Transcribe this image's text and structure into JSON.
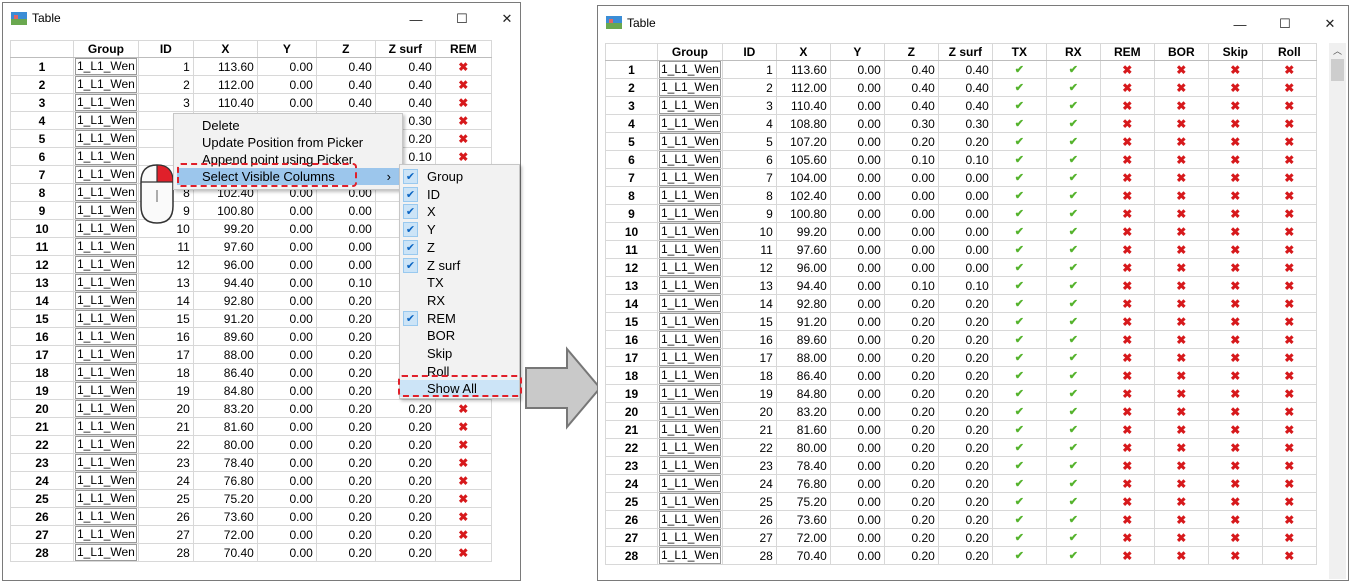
{
  "left_window": {
    "title": "Table",
    "minimize_label": "—",
    "maximize_label": "☐",
    "close_label": "✕",
    "columns": [
      "Group",
      "ID",
      "X",
      "Y",
      "Z",
      "Z surf",
      "REM"
    ],
    "context_menu": {
      "items": [
        "Delete",
        "Update Position from Picker",
        "Append point using Picker",
        "Select Visible Columns"
      ],
      "submenu_arrow": "›",
      "submenu": {
        "items": [
          {
            "label": "Group",
            "checked": true
          },
          {
            "label": "ID",
            "checked": true
          },
          {
            "label": "X",
            "checked": true
          },
          {
            "label": "Y",
            "checked": true
          },
          {
            "label": "Z",
            "checked": true
          },
          {
            "label": "Z surf",
            "checked": true
          },
          {
            "label": "TX",
            "checked": false
          },
          {
            "label": "RX",
            "checked": false
          },
          {
            "label": "REM",
            "checked": true
          },
          {
            "label": "BOR",
            "checked": false
          },
          {
            "label": "Skip",
            "checked": false
          },
          {
            "label": "Roll",
            "checked": false
          },
          {
            "label": "Show All",
            "checked": false
          }
        ]
      }
    }
  },
  "right_window": {
    "title": "Table",
    "minimize_label": "—",
    "maximize_label": "☐",
    "close_label": "✕",
    "columns": [
      "Group",
      "ID",
      "X",
      "Y",
      "Z",
      "Z surf",
      "TX",
      "RX",
      "REM",
      "BOR",
      "Skip",
      "Roll"
    ]
  },
  "icons": {
    "check": "✔",
    "cross": "✖",
    "check_icon_name": "check-icon",
    "cross_icon_name": "cross-icon"
  },
  "rows": [
    {
      "n": "1",
      "group": "1_L1_Wen",
      "id": "1",
      "x": "113.60",
      "y": "0.00",
      "z": "0.40",
      "zs": "0.40"
    },
    {
      "n": "2",
      "group": "1_L1_Wen",
      "id": "2",
      "x": "112.00",
      "y": "0.00",
      "z": "0.40",
      "zs": "0.40"
    },
    {
      "n": "3",
      "group": "1_L1_Wen",
      "id": "3",
      "x": "110.40",
      "y": "0.00",
      "z": "0.40",
      "zs": "0.40"
    },
    {
      "n": "4",
      "group": "1_L1_Wen",
      "id": "4",
      "x": "108.80",
      "y": "0.00",
      "z": "0.30",
      "zs": "0.30"
    },
    {
      "n": "5",
      "group": "1_L1_Wen",
      "id": "5",
      "x": "107.20",
      "y": "0.00",
      "z": "0.20",
      "zs": "0.20"
    },
    {
      "n": "6",
      "group": "1_L1_Wen",
      "id": "6",
      "x": "105.60",
      "y": "0.00",
      "z": "0.10",
      "zs": "0.10"
    },
    {
      "n": "7",
      "group": "1_L1_Wen",
      "id": "7",
      "x": "104.00",
      "y": "0.00",
      "z": "0.00",
      "zs": "0.00"
    },
    {
      "n": "8",
      "group": "1_L1_Wen",
      "id": "8",
      "x": "102.40",
      "y": "0.00",
      "z": "0.00",
      "zs": "0.00"
    },
    {
      "n": "9",
      "group": "1_L1_Wen",
      "id": "9",
      "x": "100.80",
      "y": "0.00",
      "z": "0.00",
      "zs": "0.00"
    },
    {
      "n": "10",
      "group": "1_L1_Wen",
      "id": "10",
      "x": "99.20",
      "y": "0.00",
      "z": "0.00",
      "zs": "0.00"
    },
    {
      "n": "11",
      "group": "1_L1_Wen",
      "id": "11",
      "x": "97.60",
      "y": "0.00",
      "z": "0.00",
      "zs": "0.00"
    },
    {
      "n": "12",
      "group": "1_L1_Wen",
      "id": "12",
      "x": "96.00",
      "y": "0.00",
      "z": "0.00",
      "zs": "0.00"
    },
    {
      "n": "13",
      "group": "1_L1_Wen",
      "id": "13",
      "x": "94.40",
      "y": "0.00",
      "z": "0.10",
      "zs": "0.10"
    },
    {
      "n": "14",
      "group": "1_L1_Wen",
      "id": "14",
      "x": "92.80",
      "y": "0.00",
      "z": "0.20",
      "zs": "0.20"
    },
    {
      "n": "15",
      "group": "1_L1_Wen",
      "id": "15",
      "x": "91.20",
      "y": "0.00",
      "z": "0.20",
      "zs": "0.20"
    },
    {
      "n": "16",
      "group": "1_L1_Wen",
      "id": "16",
      "x": "89.60",
      "y": "0.00",
      "z": "0.20",
      "zs": "0.20"
    },
    {
      "n": "17",
      "group": "1_L1_Wen",
      "id": "17",
      "x": "88.00",
      "y": "0.00",
      "z": "0.20",
      "zs": "0.20"
    },
    {
      "n": "18",
      "group": "1_L1_Wen",
      "id": "18",
      "x": "86.40",
      "y": "0.00",
      "z": "0.20",
      "zs": "0.20"
    },
    {
      "n": "19",
      "group": "1_L1_Wen",
      "id": "19",
      "x": "84.80",
      "y": "0.00",
      "z": "0.20",
      "zs": "0.20"
    },
    {
      "n": "20",
      "group": "1_L1_Wen",
      "id": "20",
      "x": "83.20",
      "y": "0.00",
      "z": "0.20",
      "zs": "0.20"
    },
    {
      "n": "21",
      "group": "1_L1_Wen",
      "id": "21",
      "x": "81.60",
      "y": "0.00",
      "z": "0.20",
      "zs": "0.20"
    },
    {
      "n": "22",
      "group": "1_L1_Wen",
      "id": "22",
      "x": "80.00",
      "y": "0.00",
      "z": "0.20",
      "zs": "0.20"
    },
    {
      "n": "23",
      "group": "1_L1_Wen",
      "id": "23",
      "x": "78.40",
      "y": "0.00",
      "z": "0.20",
      "zs": "0.20"
    },
    {
      "n": "24",
      "group": "1_L1_Wen",
      "id": "24",
      "x": "76.80",
      "y": "0.00",
      "z": "0.20",
      "zs": "0.20"
    },
    {
      "n": "25",
      "group": "1_L1_Wen",
      "id": "25",
      "x": "75.20",
      "y": "0.00",
      "z": "0.20",
      "zs": "0.20"
    },
    {
      "n": "26",
      "group": "1_L1_Wen",
      "id": "26",
      "x": "73.60",
      "y": "0.00",
      "z": "0.20",
      "zs": "0.20"
    },
    {
      "n": "27",
      "group": "1_L1_Wen",
      "id": "27",
      "x": "72.00",
      "y": "0.00",
      "z": "0.20",
      "zs": "0.20"
    },
    {
      "n": "28",
      "group": "1_L1_Wen",
      "id": "28",
      "x": "70.40",
      "y": "0.00",
      "z": "0.20",
      "zs": "0.20"
    }
  ],
  "flags": {
    "TX": "check",
    "RX": "check",
    "REM": "cross",
    "BOR": "cross",
    "Skip": "cross",
    "Roll": "cross"
  },
  "colors": {
    "cross": "#d7191c",
    "check": "#55b32d",
    "highlight": "#cce4f7",
    "annotation": "#e0202a"
  }
}
